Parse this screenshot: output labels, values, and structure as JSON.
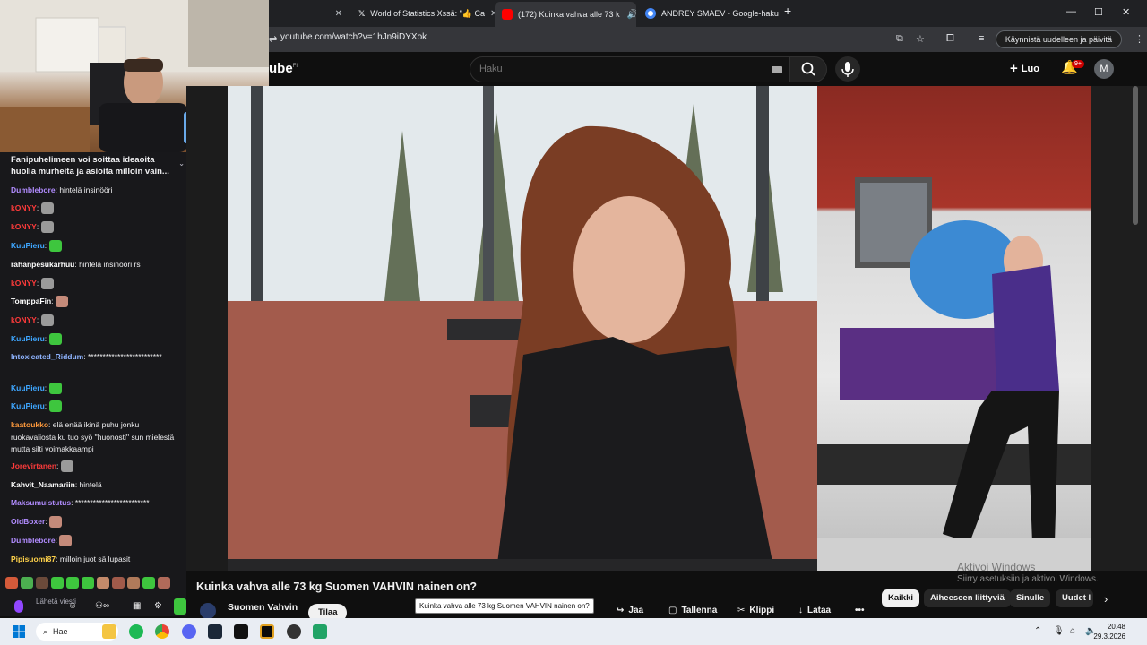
{
  "browser": {
    "tabs": [
      {
        "label": "",
        "active": false
      },
      {
        "label": "World of Statistics Xssä: \"👍 Ca",
        "active": false
      },
      {
        "label": "(172) Kuinka vahva alle 73 k",
        "active": true
      },
      {
        "label": "ANDREY SMAEV - Google-haku",
        "active": false
      }
    ],
    "url": "youtube.com/watch?v=1hJn9iDYXok",
    "restart_label": "Käynnistä uudelleen ja päivitä",
    "profile_initial": "M"
  },
  "youtube": {
    "logo_text": "ube",
    "logo_country": "FI",
    "search_placeholder": "Haku",
    "create_label": "Luo",
    "notification_count": "9+",
    "avatar_initial": "M",
    "video_title": "Kuinka vahva alle 73 kg Suomen VAHVIN nainen on?",
    "tooltip": "Kuinka vahva alle 73 kg Suomen VAHVIN nainen on?",
    "channel_name": "Suomen Vahvin",
    "subscribe_label": "Tilaa",
    "actions": {
      "share": "Jaa",
      "save": "Tallenna",
      "clip": "Klippi",
      "download": "Lataa"
    },
    "chips": [
      "Kaikki",
      "Aiheeseen liittyviä",
      "Sinulle",
      "Uudet l"
    ],
    "watermark": "Aktivoi Windows",
    "watermark_sub": "Siirry asetuksiin ja aktivoi Windows."
  },
  "chat": {
    "pinned": "Fanipuhelimeen voi soittaa ideaoita huolia murheita ja asioita milloin vain...",
    "messages": [
      {
        "user": "Dumblebore",
        "color": "#b18cff",
        "text": "hintelä insinööri"
      },
      {
        "user": "kONYY",
        "color": "#ff3b3b",
        "text": ""
      },
      {
        "user": "kONYY",
        "color": "#ff3b3b",
        "text": ""
      },
      {
        "user": "KuuPieru",
        "color": "#3ea6ff",
        "text": ""
      },
      {
        "user": "rahanpesukarhuu",
        "color": "#ffffff",
        "text": "hintelä insinööri rs"
      },
      {
        "user": "kONYY",
        "color": "#ff3b3b",
        "text": ""
      },
      {
        "user": "TomppaFin",
        "color": "#ffffff",
        "text": ""
      },
      {
        "user": "kONYY",
        "color": "#ff3b3b",
        "text": ""
      },
      {
        "user": "KuuPieru",
        "color": "#3ea6ff",
        "text": ""
      },
      {
        "user": "Intoxicated_Riddum",
        "color": "#8fb4ff",
        "text": "*************************"
      },
      {
        "user": "KuuPieru",
        "color": "#3ea6ff",
        "text": ""
      },
      {
        "user": "KuuPieru",
        "color": "#3ea6ff",
        "text": ""
      },
      {
        "user": "kaatoukko",
        "color": "#ff9a3c",
        "text": "elä enää ikinä puhu jonku ruokavaliosta ku tuo syö ''huonosti'' sun mielestä mutta silti voimakkaampi"
      },
      {
        "user": "Jorevirtanen",
        "color": "#ff3b3b",
        "text": ""
      },
      {
        "user": "Kahvit_Naamariin",
        "color": "#ffffff",
        "text": "hintelä"
      },
      {
        "user": "Maksumuistutus",
        "color": "#b18cff",
        "text": "*************************"
      },
      {
        "user": "OldBoxer",
        "color": "#b18cff",
        "text": ""
      },
      {
        "user": "Dumblebore",
        "color": "#b18cff",
        "text": ""
      },
      {
        "user": "Pipisuomi87",
        "color": "#ffd24a",
        "text": "milloin juot sä lupasit"
      }
    ],
    "input_placeholder": "Lähetä viesti"
  },
  "taskbar": {
    "search_label": "Hae",
    "time": "20.48",
    "date": "29.3.2026"
  }
}
